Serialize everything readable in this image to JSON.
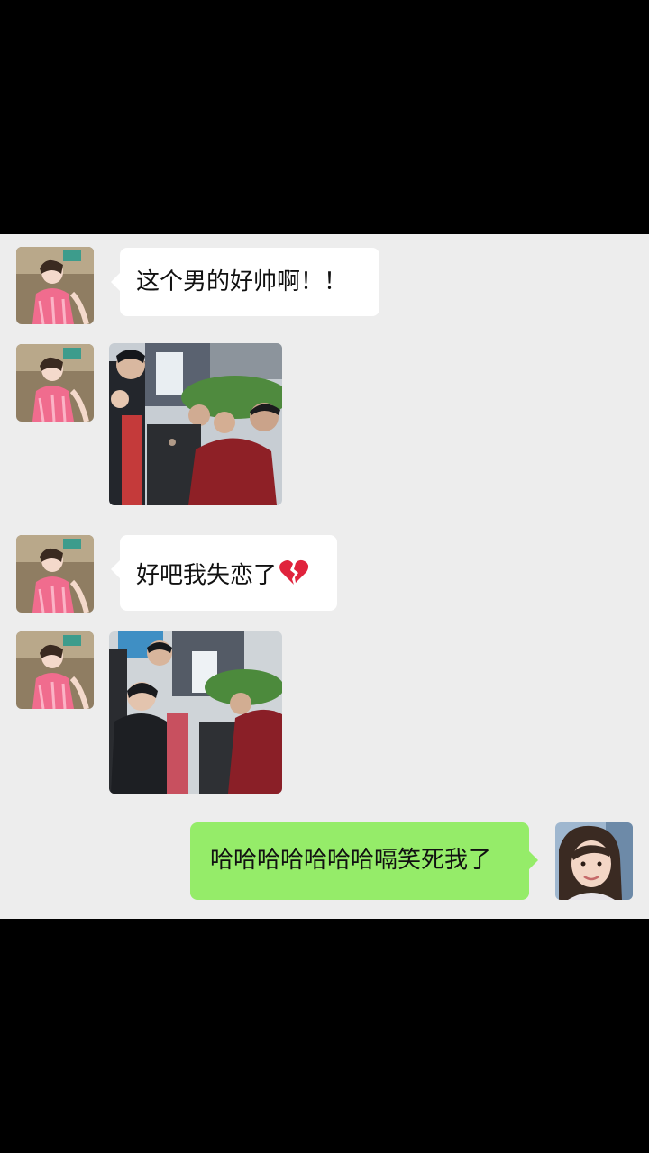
{
  "messages": [
    {
      "side": "left",
      "type": "text",
      "text": "这个男的好帅啊！！"
    },
    {
      "side": "left",
      "type": "image",
      "content": "street-crowd-photo"
    },
    {
      "side": "left",
      "type": "text",
      "text": "好吧我失恋了",
      "emoji": "broken-heart-icon"
    },
    {
      "side": "left",
      "type": "image",
      "content": "street-crowd-photo"
    },
    {
      "side": "right",
      "type": "text",
      "text": "哈哈哈哈哈哈哈嗝笑死我了"
    }
  ],
  "colors": {
    "chat_background": "#ededed",
    "letterbox": "#000000",
    "incoming_bubble": "#ffffff",
    "outgoing_bubble": "#95ec69",
    "broken_heart": "#e0233c"
  }
}
